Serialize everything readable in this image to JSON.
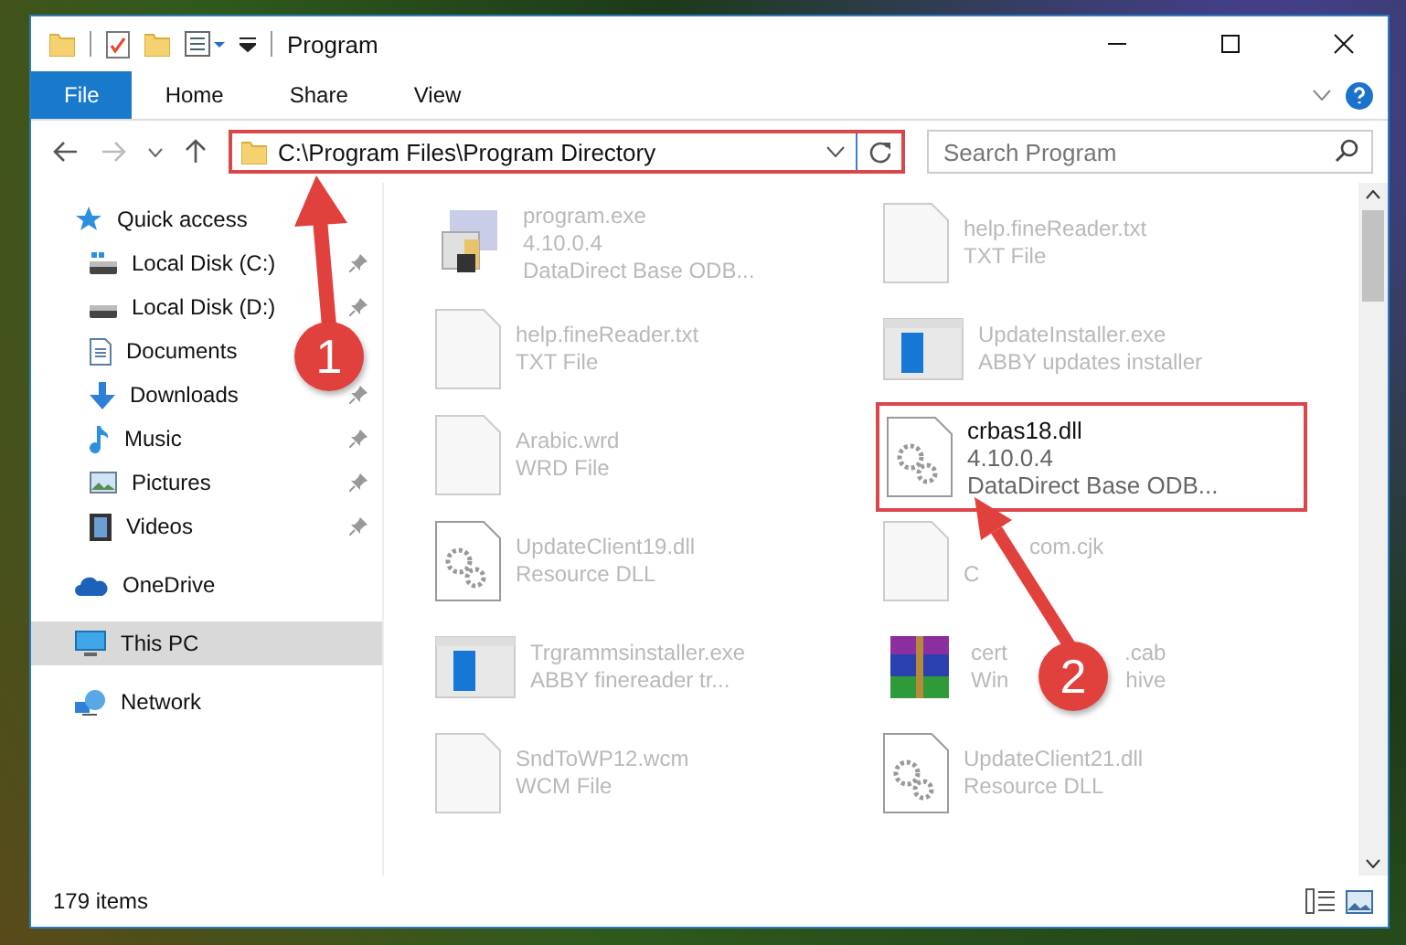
{
  "window": {
    "title": "Program"
  },
  "ribbon": {
    "tabs": [
      {
        "label": "File",
        "selected": true
      },
      {
        "label": "Home",
        "selected": false
      },
      {
        "label": "Share",
        "selected": false
      },
      {
        "label": "View",
        "selected": false
      }
    ]
  },
  "address_bar": {
    "path": "C:\\Program Files\\Program Directory",
    "highlighted": true
  },
  "search": {
    "placeholder": "Search Program"
  },
  "sidebar": {
    "items": [
      {
        "label": "Quick access",
        "kind": "star",
        "selected": false,
        "children": [
          {
            "label": "Local Disk (C:)",
            "kind": "systemdrive",
            "pinned": true
          },
          {
            "label": "Local Disk (D:)",
            "kind": "drive",
            "pinned": true
          },
          {
            "label": "Documents",
            "kind": "documents"
          },
          {
            "label": "Downloads",
            "kind": "downloads",
            "pinned": true
          },
          {
            "label": "Music",
            "kind": "music",
            "pinned": true
          },
          {
            "label": "Pictures",
            "kind": "pictures",
            "pinned": true
          },
          {
            "label": "Videos",
            "kind": "videos",
            "pinned": true
          }
        ]
      },
      {
        "label": "OneDrive",
        "kind": "cloud",
        "selected": false
      },
      {
        "label": "This PC",
        "kind": "pc",
        "selected": true
      },
      {
        "label": "Network",
        "kind": "network",
        "selected": false
      }
    ]
  },
  "files": [
    {
      "name": "program.exe",
      "details": [
        "4.10.0.4",
        "DataDirect Base ODB..."
      ],
      "kind": "exe",
      "highlighted": false
    },
    {
      "name": "help.fineReader.txt",
      "details": [
        "TXT File"
      ],
      "kind": "text",
      "highlighted": false
    },
    {
      "name": "help.fineReader.txt",
      "details": [
        "TXT File"
      ],
      "kind": "text",
      "highlighted": false
    },
    {
      "name": "UpdateInstaller.exe",
      "details": [
        "ABBY updates installer"
      ],
      "kind": "installer",
      "highlighted": false
    },
    {
      "name": "Arabic.wrd",
      "details": [
        "WRD File"
      ],
      "kind": "document",
      "highlighted": false
    },
    {
      "name": "crbas18.dll",
      "details": [
        "4.10.0.4",
        "DataDirect Base ODB..."
      ],
      "kind": "dll",
      "highlighted": true
    },
    {
      "name": "UpdateClient19.dll",
      "details": [
        "Resource DLL"
      ],
      "kind": "dll",
      "highlighted": false
    },
    {
      "name": "com.cjk",
      "covered_start": true,
      "details": [
        "C"
      ],
      "kind": "document",
      "highlighted": false
    },
    {
      "name": "Trgrammsinstaller.exe",
      "details": [
        "ABBY finereader tr..."
      ],
      "kind": "installer",
      "highlighted": false
    },
    {
      "name": [
        "cert",
        ".cab"
      ],
      "details": [
        [
          "Win",
          "hive"
        ]
      ],
      "kind": "archive",
      "highlighted": false
    },
    {
      "name": "SndToWP12.wcm",
      "details": [
        "WCM File"
      ],
      "kind": "document",
      "highlighted": false
    },
    {
      "name": "UpdateClient21.dll",
      "details": [
        "Resource DLL"
      ],
      "kind": "dll",
      "highlighted": false
    }
  ],
  "status_bar": {
    "count": "179 items"
  },
  "callouts": [
    {
      "number": "1"
    },
    {
      "number": "2"
    }
  ]
}
